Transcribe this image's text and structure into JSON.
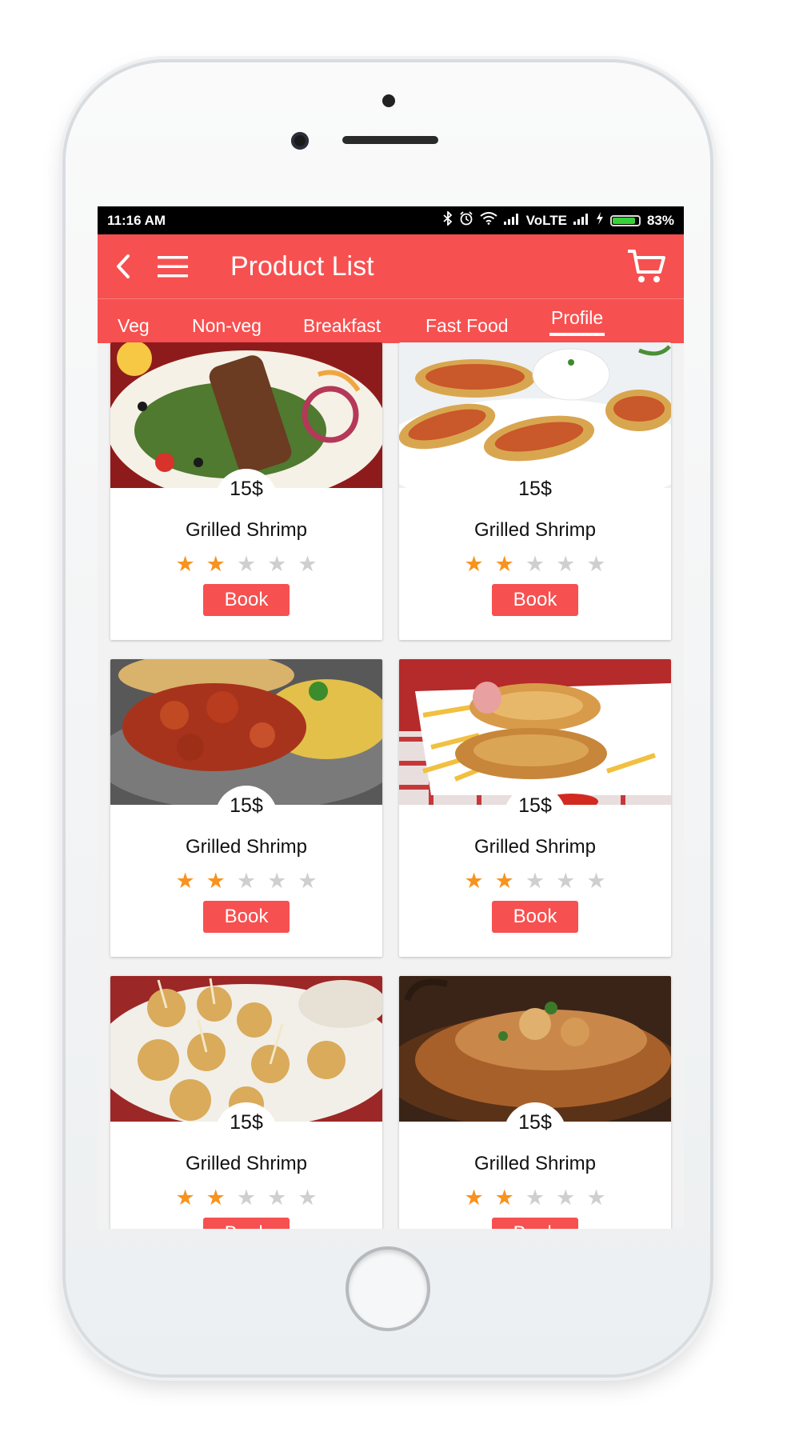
{
  "status_bar": {
    "time": "11:16 AM",
    "network": "VoLTE",
    "battery": "83%",
    "battery_level": 0.83
  },
  "app_bar": {
    "title": "Product List",
    "back_icon": "chevron-left-icon",
    "menu_icon": "hamburger-menu-icon",
    "cart_icon": "shopping-cart-icon"
  },
  "tabs": [
    {
      "label": "Veg",
      "active": false
    },
    {
      "label": "Non-veg",
      "active": false
    },
    {
      "label": "Breakfast",
      "active": false
    },
    {
      "label": "Fast Food",
      "active": false
    },
    {
      "label": "Profile",
      "active": true
    }
  ],
  "colors": {
    "accent": "#f75050",
    "star_filled": "#f7931e",
    "star_empty": "#cfcfcf"
  },
  "products": [
    {
      "name": "Grilled Shrimp",
      "price": "15$",
      "rating": 2,
      "max_rating": 5,
      "book_label": "Book"
    },
    {
      "name": "Grilled Shrimp",
      "price": "15$",
      "rating": 2,
      "max_rating": 5,
      "book_label": "Book"
    },
    {
      "name": "Grilled Shrimp",
      "price": "15$",
      "rating": 2,
      "max_rating": 5,
      "book_label": "Book"
    },
    {
      "name": "Grilled Shrimp",
      "price": "15$",
      "rating": 2,
      "max_rating": 5,
      "book_label": "Book"
    },
    {
      "name": "Grilled Shrimp",
      "price": "15$",
      "rating": 2,
      "max_rating": 5,
      "book_label": "Book"
    },
    {
      "name": "Grilled Shrimp",
      "price": "15$",
      "rating": 2,
      "max_rating": 5,
      "book_label": "Book"
    }
  ]
}
